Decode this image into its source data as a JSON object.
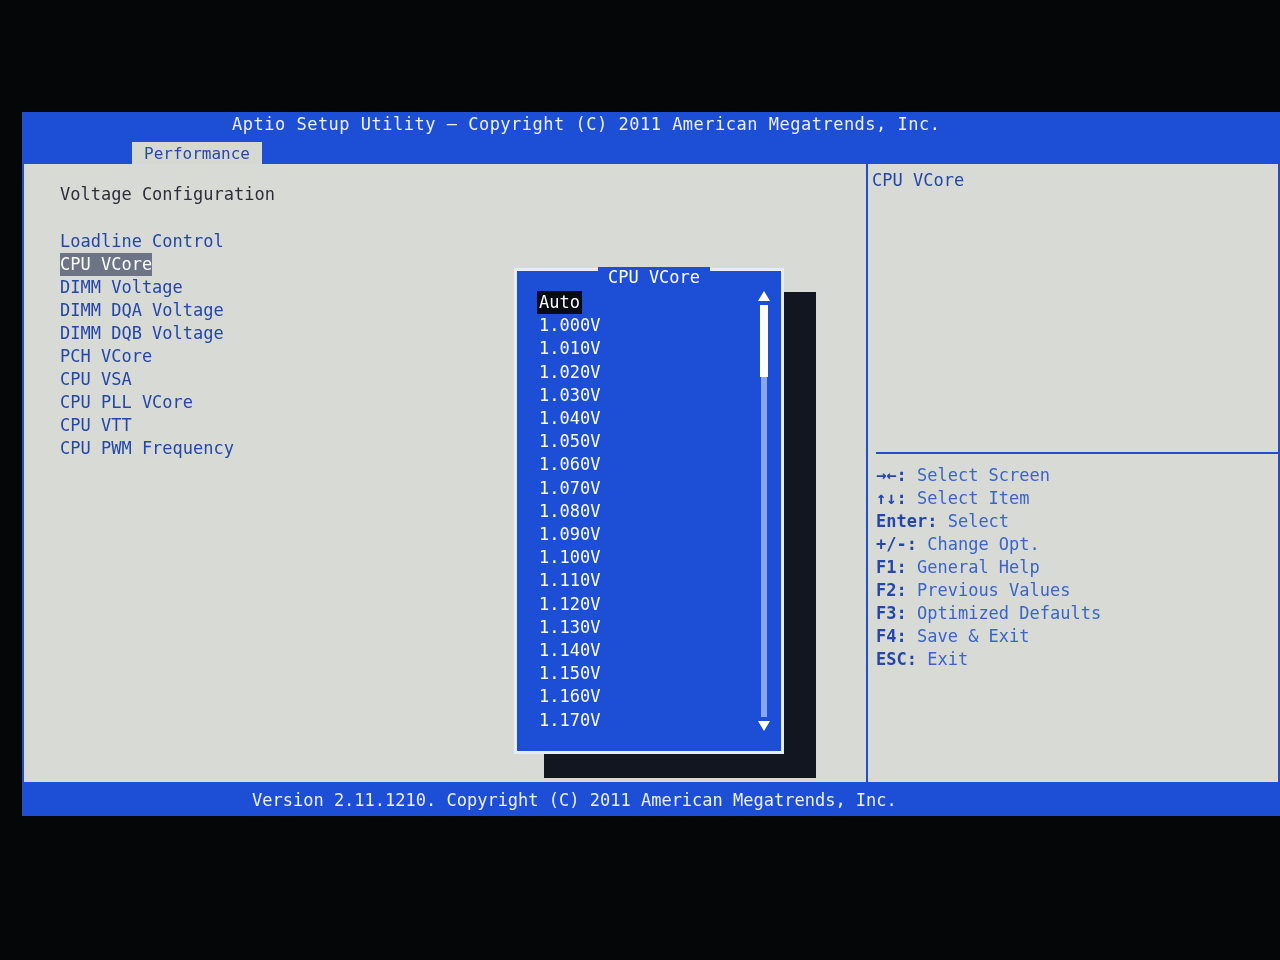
{
  "header": {
    "title": "Aptio Setup Utility – Copyright (C) 2011 American Megatrends, Inc.",
    "tabs": [
      {
        "label": "Performance",
        "selected": true
      }
    ]
  },
  "main": {
    "section_title": "Voltage Configuration",
    "items": [
      {
        "label": "Loadline Control",
        "selected": false
      },
      {
        "label": "CPU VCore",
        "selected": true
      },
      {
        "label": "DIMM Voltage",
        "selected": false
      },
      {
        "label": "DIMM DQA Voltage",
        "selected": false
      },
      {
        "label": "DIMM DQB Voltage",
        "selected": false
      },
      {
        "label": "PCH VCore",
        "selected": false
      },
      {
        "label": "CPU VSA",
        "selected": false
      },
      {
        "label": "CPU PLL VCore",
        "selected": false
      },
      {
        "label": "CPU VTT",
        "selected": false
      },
      {
        "label": "CPU PWM Frequency",
        "selected": false
      }
    ]
  },
  "popup": {
    "title": "CPU VCore",
    "options": [
      {
        "label": "Auto",
        "selected": true
      },
      {
        "label": "1.000V",
        "selected": false
      },
      {
        "label": "1.010V",
        "selected": false
      },
      {
        "label": "1.020V",
        "selected": false
      },
      {
        "label": "1.030V",
        "selected": false
      },
      {
        "label": "1.040V",
        "selected": false
      },
      {
        "label": "1.050V",
        "selected": false
      },
      {
        "label": "1.060V",
        "selected": false
      },
      {
        "label": "1.070V",
        "selected": false
      },
      {
        "label": "1.080V",
        "selected": false
      },
      {
        "label": "1.090V",
        "selected": false
      },
      {
        "label": "1.100V",
        "selected": false
      },
      {
        "label": "1.110V",
        "selected": false
      },
      {
        "label": "1.120V",
        "selected": false
      },
      {
        "label": "1.130V",
        "selected": false
      },
      {
        "label": "1.140V",
        "selected": false
      },
      {
        "label": "1.150V",
        "selected": false
      },
      {
        "label": "1.160V",
        "selected": false
      },
      {
        "label": "1.170V",
        "selected": false
      }
    ]
  },
  "help": {
    "description": "CPU VCore",
    "keys": [
      {
        "key": "→←:",
        "action": "Select Screen"
      },
      {
        "key": "↑↓:",
        "action": "Select Item"
      },
      {
        "key": "Enter:",
        "action": "Select"
      },
      {
        "key": "+/-:",
        "action": "Change Opt."
      },
      {
        "key": "F1:",
        "action": "General Help"
      },
      {
        "key": "F2:",
        "action": "Previous Values"
      },
      {
        "key": "F3:",
        "action": "Optimized Defaults"
      },
      {
        "key": "F4:",
        "action": "Save & Exit"
      },
      {
        "key": "ESC:",
        "action": "Exit"
      }
    ]
  },
  "footer": {
    "text": "Version 2.11.1210. Copyright (C) 2011 American Megatrends, Inc."
  }
}
